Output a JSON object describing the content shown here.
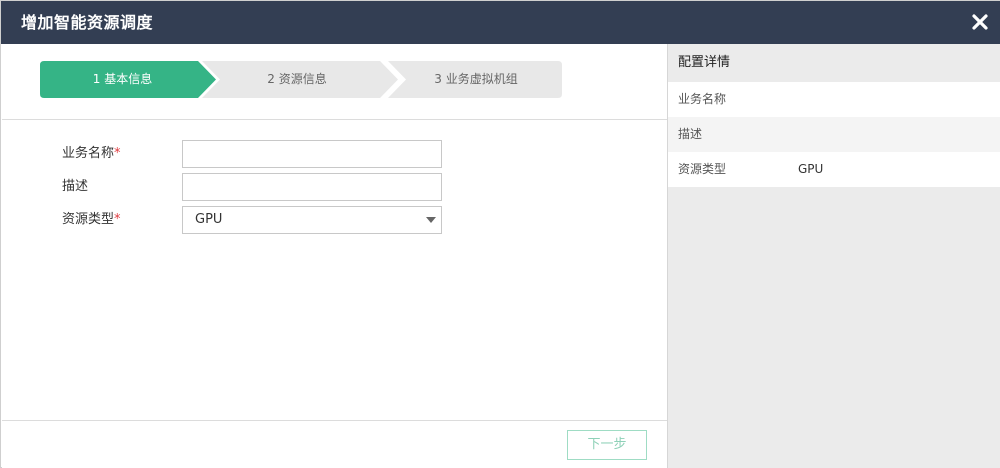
{
  "dialog": {
    "title": "增加智能资源调度",
    "close_icon": "close-icon"
  },
  "steps": [
    {
      "label": "1 基本信息",
      "active": true
    },
    {
      "label": "2 资源信息",
      "active": false
    },
    {
      "label": "3 业务虚拟机组",
      "active": false
    }
  ],
  "form": {
    "name_label": "业务名称",
    "name_value": "",
    "desc_label": "描述",
    "desc_value": "",
    "type_label": "资源类型",
    "type_value": "GPU",
    "required_mark": "*"
  },
  "footer": {
    "next_label": "下一步"
  },
  "details": {
    "title": "配置详情",
    "rows": [
      {
        "key": "业务名称",
        "value": ""
      },
      {
        "key": "描述",
        "value": ""
      },
      {
        "key": "资源类型",
        "value": "GPU"
      }
    ]
  },
  "colors": {
    "titlebar": "#333e53",
    "step_active": "#35b486",
    "step_inactive": "#e8e8e8",
    "required": "#e0393e"
  }
}
